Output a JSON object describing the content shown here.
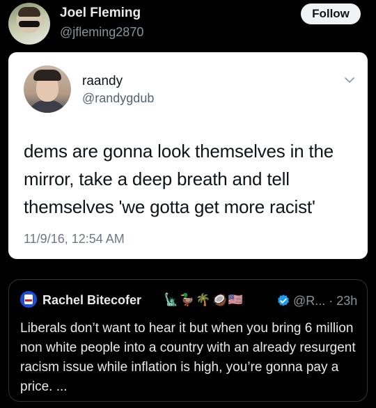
{
  "post": {
    "author_name": "Joel Fleming",
    "author_handle": "@jfleming2870",
    "follow_label": "Follow"
  },
  "embedded_tweet": {
    "author_name": "raandy",
    "author_handle": "@randygdub",
    "text": "dems are gonna look themselves in the mirror, take a deep breath and tell themselves 'we gotta get more racist'",
    "timestamp": "11/9/16, 12:54 AM"
  },
  "quoted_tweet": {
    "author_name": "Rachel Bitecofer",
    "name_emojis": [
      "🗽",
      "🦆",
      "🌴",
      "🥥",
      "🇺🇸"
    ],
    "handle_and_time": "@R... · 23h",
    "text": "Liberals don’t want to hear it but when you bring 6 million non white people into a country with an already resurgent racism issue while inflation is high, you’re gonna pay a price. ..."
  },
  "colors": {
    "background": "#000000",
    "card": "#ffffff",
    "verified": "#1d9bf0",
    "muted": "#8b949a"
  }
}
